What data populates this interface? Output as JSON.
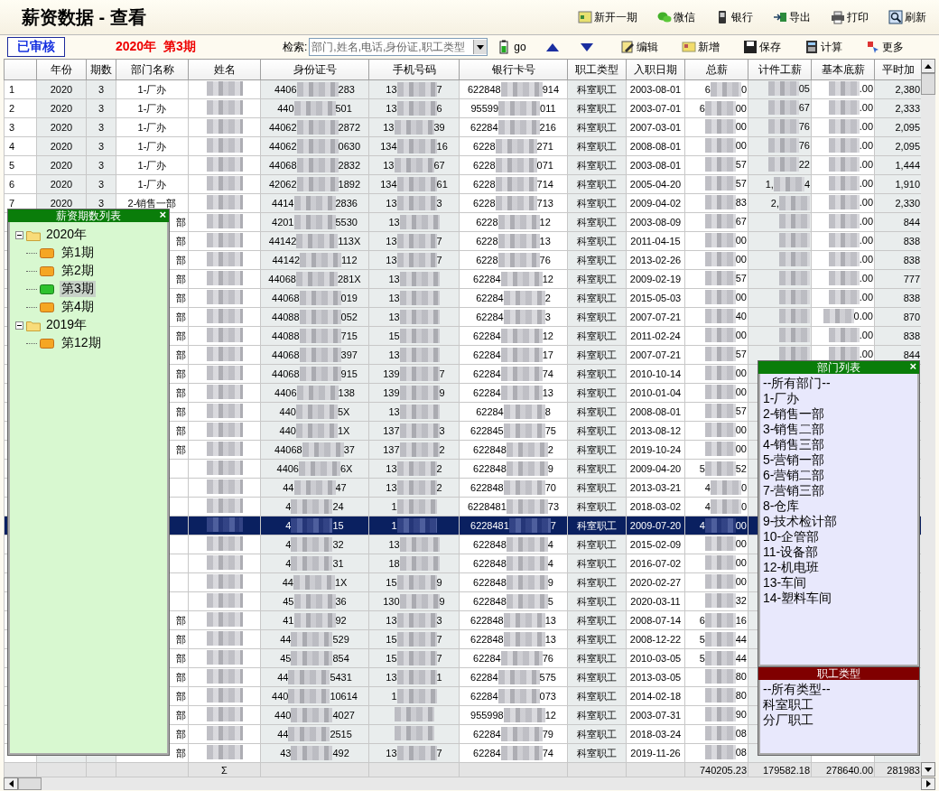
{
  "title": "薪资数据 - 查看",
  "top_actions": [
    "新开一期",
    "微信",
    "银行",
    "导出",
    "打印",
    "刷新"
  ],
  "status_badge": "已审核",
  "period_label": "2020年  第3期",
  "search": {
    "label": "检索:",
    "placeholder": "部门,姓名,电话,身份证,职工类型",
    "go": "go"
  },
  "edit_actions": [
    "编辑",
    "新增",
    "保存",
    "计算",
    "更多"
  ],
  "columns": [
    "年份",
    "期数",
    "部门名称",
    "姓名",
    "身份证号",
    "手机号码",
    "银行卡号",
    "职工类型",
    "入职日期",
    "总薪",
    "计件工薪",
    "基本底薪",
    "平时加"
  ],
  "rows": [
    {
      "selected": false,
      "cells": [
        "1",
        "2020",
        "3",
        "1-厂办",
        {
          "blurred": true
        },
        {
          "pre": "4406",
          "post": "283"
        },
        {
          "pre": "13",
          "post": "7"
        },
        {
          "pre": "622848",
          "post": "914"
        },
        "科室职工",
        "2003-08-01",
        {
          "pre": "6",
          "post": "0"
        },
        {
          "post": "05"
        },
        {
          "post": ".00"
        },
        "2,380"
      ]
    },
    {
      "selected": false,
      "cells": [
        "2",
        "2020",
        "3",
        "1-厂办",
        {
          "blurred": true
        },
        {
          "pre": "440",
          "post": "501"
        },
        {
          "pre": "13",
          "post": "6"
        },
        {
          "pre": "95599",
          "post": "011"
        },
        "科室职工",
        "2003-07-01",
        {
          "pre": "6",
          "post": "00"
        },
        {
          "post": "67"
        },
        {
          "post": ".00"
        },
        "2,333"
      ]
    },
    {
      "selected": false,
      "cells": [
        "3",
        "2020",
        "3",
        "1-厂办",
        {
          "blurred": true
        },
        {
          "pre": "44062",
          "post": "2872"
        },
        {
          "pre": "13",
          "post": "39"
        },
        {
          "pre": "62284",
          "post": "216"
        },
        "科室职工",
        "2007-03-01",
        {
          "post": "00"
        },
        {
          "post": "76"
        },
        {
          "post": ".00"
        },
        "2,095"
      ]
    },
    {
      "selected": false,
      "cells": [
        "4",
        "2020",
        "3",
        "1-厂办",
        {
          "blurred": true
        },
        {
          "pre": "44062",
          "post": "0630"
        },
        {
          "pre": "134",
          "post": "16"
        },
        {
          "pre": "6228",
          "post": "271"
        },
        "科室职工",
        "2008-08-01",
        {
          "post": "00"
        },
        {
          "post": "76"
        },
        {
          "post": ".00"
        },
        "2,095"
      ]
    },
    {
      "selected": false,
      "cells": [
        "5",
        "2020",
        "3",
        "1-厂办",
        {
          "blurred": true
        },
        {
          "pre": "44068",
          "post": "2832"
        },
        {
          "pre": "13",
          "post": "67"
        },
        {
          "pre": "6228",
          "post": "071"
        },
        "科室职工",
        "2003-08-01",
        {
          "post": "57"
        },
        {
          "post": "22"
        },
        {
          "post": ".00"
        },
        "1,444"
      ]
    },
    {
      "selected": false,
      "cells": [
        "6",
        "2020",
        "3",
        "1-厂办",
        {
          "blurred": true
        },
        {
          "pre": "42062",
          "post": "1892"
        },
        {
          "pre": "134",
          "post": "61"
        },
        {
          "pre": "6228",
          "post": "714"
        },
        "科室职工",
        "2005-04-20",
        {
          "post": "57"
        },
        {
          "pre": "1,",
          "post": "4"
        },
        {
          "post": ".00"
        },
        "1,910"
      ]
    },
    {
      "selected": false,
      "cells": [
        "7",
        "2020",
        "3",
        "2-销售一部",
        {
          "blurred": true
        },
        {
          "pre": "4414",
          "post": "2836"
        },
        {
          "pre": "13",
          "post": "3"
        },
        {
          "pre": "6228",
          "post": "713"
        },
        "科室职工",
        "2009-04-02",
        {
          "post": "83"
        },
        {
          "pre": "2,"
        },
        {
          "post": ".00"
        },
        "2,330"
      ]
    },
    {
      "selected": false,
      "cells": [
        null,
        null,
        null,
        "部",
        {
          "blurred": true
        },
        {
          "pre": "4201",
          "post": "5530"
        },
        {
          "pre": "13"
        },
        {
          "pre": "6228",
          "post": "12"
        },
        "科室职工",
        "2003-08-09",
        {
          "post": "67"
        },
        {
          "blurred": true
        },
        {
          "post": ".00"
        },
        "844"
      ]
    },
    {
      "selected": false,
      "cells": [
        null,
        null,
        null,
        "部",
        {
          "blurred": true
        },
        {
          "pre": "44142",
          "post": "113X"
        },
        {
          "pre": "13",
          "post": "7"
        },
        {
          "pre": "6228",
          "post": "13"
        },
        "科室职工",
        "2011-04-15",
        {
          "post": "00"
        },
        {
          "blurred": true
        },
        {
          "post": ".00"
        },
        "838"
      ]
    },
    {
      "selected": false,
      "cells": [
        null,
        null,
        null,
        "部",
        {
          "blurred": true
        },
        {
          "pre": "44142",
          "post": "112"
        },
        {
          "pre": "13",
          "post": "7"
        },
        {
          "pre": "6228",
          "post": "76"
        },
        "科室职工",
        "2013-02-26",
        {
          "post": "00"
        },
        {
          "blurred": true
        },
        {
          "post": ".00"
        },
        "838"
      ]
    },
    {
      "selected": false,
      "cells": [
        null,
        null,
        null,
        "部",
        {
          "blurred": true
        },
        {
          "pre": "44068",
          "post": "281X"
        },
        {
          "pre": "13"
        },
        {
          "pre": "62284",
          "post": "12"
        },
        "科室职工",
        "2009-02-19",
        {
          "post": "57"
        },
        {
          "blurred": true
        },
        {
          "post": ".00"
        },
        "777"
      ]
    },
    {
      "selected": false,
      "cells": [
        null,
        null,
        null,
        "部",
        {
          "blurred": true
        },
        {
          "pre": "44068",
          "post": "019"
        },
        {
          "pre": "13"
        },
        {
          "pre": "62284",
          "post": "2"
        },
        "科室职工",
        "2015-05-03",
        {
          "post": "00"
        },
        {
          "blurred": true
        },
        {
          "post": ".00"
        },
        "838"
      ]
    },
    {
      "selected": false,
      "cells": [
        null,
        null,
        null,
        "部",
        {
          "blurred": true
        },
        {
          "pre": "44088",
          "post": "052"
        },
        {
          "pre": "13"
        },
        {
          "pre": "62284",
          "post": "3"
        },
        "科室职工",
        "2007-07-21",
        {
          "post": "40"
        },
        {
          "blurred": true
        },
        {
          "post": "0.00"
        },
        "870"
      ]
    },
    {
      "selected": false,
      "cells": [
        null,
        null,
        null,
        "部",
        {
          "blurred": true
        },
        {
          "pre": "44088",
          "post": "715"
        },
        {
          "pre": "15"
        },
        {
          "pre": "62284",
          "post": "12"
        },
        "科室职工",
        "2011-02-24",
        {
          "post": "00"
        },
        {
          "blurred": true
        },
        {
          "post": ".00"
        },
        "838"
      ]
    },
    {
      "selected": false,
      "cells": [
        null,
        null,
        null,
        "部",
        {
          "blurred": true
        },
        {
          "pre": "44068",
          "post": "397"
        },
        {
          "pre": "13"
        },
        {
          "pre": "62284",
          "post": "17"
        },
        "科室职工",
        "2007-07-21",
        {
          "post": "57"
        },
        {
          "blurred": true
        },
        {
          "post": ".00"
        },
        "844"
      ]
    },
    {
      "selected": false,
      "cells": [
        null,
        null,
        null,
        "部",
        {
          "blurred": true
        },
        {
          "pre": "44068",
          "post": "915"
        },
        {
          "pre": "139",
          "post": "7"
        },
        {
          "pre": "62284",
          "post": "74"
        },
        "科室职工",
        "2010-10-14",
        {
          "post": "00"
        },
        null,
        null,
        null
      ]
    },
    {
      "selected": false,
      "cells": [
        null,
        null,
        null,
        "部",
        {
          "blurred": true
        },
        {
          "pre": "4406",
          "post": "138"
        },
        {
          "pre": "139",
          "post": "9"
        },
        {
          "pre": "62284",
          "post": "13"
        },
        "科室职工",
        "2010-01-04",
        {
          "post": "00"
        },
        null,
        null,
        null
      ]
    },
    {
      "selected": false,
      "cells": [
        null,
        null,
        null,
        "部",
        {
          "blurred": true
        },
        {
          "pre": "440",
          "post": "5X"
        },
        {
          "pre": "13"
        },
        {
          "pre": "62284",
          "post": "8"
        },
        "科室职工",
        "2008-08-01",
        {
          "post": "57"
        },
        null,
        null,
        null
      ]
    },
    {
      "selected": false,
      "cells": [
        null,
        null,
        null,
        "部",
        {
          "blurred": true
        },
        {
          "pre": "440",
          "post": "1X"
        },
        {
          "pre": "137",
          "post": "3"
        },
        {
          "pre": "622845",
          "post": "75"
        },
        "科室职工",
        "2013-08-12",
        {
          "post": "00"
        },
        null,
        null,
        null
      ]
    },
    {
      "selected": false,
      "cells": [
        null,
        null,
        null,
        "部",
        {
          "blurred": true
        },
        {
          "pre": "44068",
          "post": "37"
        },
        {
          "pre": "137",
          "post": "2"
        },
        {
          "pre": "622848",
          "post": "2"
        },
        "科室职工",
        "2019-10-24",
        {
          "post": "00"
        },
        null,
        null,
        null
      ]
    },
    {
      "selected": false,
      "cells": [
        null,
        null,
        null,
        null,
        {
          "blurred": true
        },
        {
          "pre": "4406",
          "post": "6X"
        },
        {
          "pre": "13",
          "post": "2"
        },
        {
          "pre": "622848",
          "post": "9"
        },
        "科室职工",
        "2009-04-20",
        {
          "pre": "5",
          "post": "52"
        },
        null,
        null,
        null
      ]
    },
    {
      "selected": false,
      "cells": [
        null,
        null,
        null,
        null,
        {
          "blurred": true
        },
        {
          "pre": "44",
          "post": "47"
        },
        {
          "pre": "13",
          "post": "2"
        },
        {
          "pre": "622848",
          "post": "70"
        },
        "科室职工",
        "2013-03-21",
        {
          "pre": "4",
          "post": "0"
        },
        null,
        null,
        null
      ]
    },
    {
      "selected": false,
      "cells": [
        null,
        null,
        null,
        null,
        {
          "blurred": true
        },
        {
          "pre": "4",
          "post": "24"
        },
        {
          "pre": "1"
        },
        {
          "pre": "6228481",
          "post": "73"
        },
        "科室职工",
        "2018-03-02",
        {
          "pre": "4",
          "post": "0"
        },
        null,
        null,
        null
      ]
    },
    {
      "selected": true,
      "cells": [
        null,
        null,
        null,
        null,
        {
          "blurred": true
        },
        {
          "pre": "4",
          "post": "15"
        },
        {
          "pre": "1"
        },
        {
          "pre": "6228481",
          "post": "7"
        },
        "科室职工",
        "2009-07-20",
        {
          "pre": "4",
          "post": "00"
        },
        null,
        null,
        null
      ]
    },
    {
      "selected": false,
      "cells": [
        null,
        null,
        null,
        null,
        {
          "blurred": true
        },
        {
          "pre": "4",
          "post": "32"
        },
        {
          "pre": "13"
        },
        {
          "pre": "622848",
          "post": "4"
        },
        "科室职工",
        "2015-02-09",
        {
          "post": "00"
        },
        null,
        null,
        null
      ]
    },
    {
      "selected": false,
      "cells": [
        null,
        null,
        null,
        null,
        {
          "blurred": true
        },
        {
          "pre": "4",
          "post": "31"
        },
        {
          "pre": "18"
        },
        {
          "pre": "622848",
          "post": "4"
        },
        "科室职工",
        "2016-07-02",
        {
          "post": "00"
        },
        null,
        null,
        null
      ]
    },
    {
      "selected": false,
      "cells": [
        null,
        null,
        null,
        null,
        {
          "blurred": true
        },
        {
          "pre": "44",
          "post": "1X"
        },
        {
          "pre": "15",
          "post": "9"
        },
        {
          "pre": "622848",
          "post": "9"
        },
        "科室职工",
        "2020-02-27",
        {
          "post": "00"
        },
        null,
        null,
        null
      ]
    },
    {
      "selected": false,
      "cells": [
        null,
        null,
        null,
        null,
        {
          "blurred": true
        },
        {
          "pre": "45",
          "post": "36"
        },
        {
          "pre": "130",
          "post": "9"
        },
        {
          "pre": "622848",
          "post": "5"
        },
        "科室职工",
        "2020-03-11",
        {
          "post": "32"
        },
        null,
        null,
        null
      ]
    },
    {
      "selected": false,
      "cells": [
        null,
        null,
        null,
        "部",
        {
          "blurred": true
        },
        {
          "pre": "41",
          "post": "92"
        },
        {
          "pre": "13",
          "post": "3"
        },
        {
          "pre": "622848",
          "post": "13"
        },
        "科室职工",
        "2008-07-14",
        {
          "pre": "6",
          "post": "16"
        },
        null,
        null,
        null
      ]
    },
    {
      "selected": false,
      "cells": [
        null,
        null,
        null,
        "部",
        {
          "blurred": true
        },
        {
          "pre": "44",
          "post": "529"
        },
        {
          "pre": "15",
          "post": "7"
        },
        {
          "pre": "622848",
          "post": "13"
        },
        "科室职工",
        "2008-12-22",
        {
          "pre": "5",
          "post": "44"
        },
        null,
        null,
        null
      ]
    },
    {
      "selected": false,
      "cells": [
        null,
        null,
        null,
        "部",
        {
          "blurred": true
        },
        {
          "pre": "45",
          "post": "854"
        },
        {
          "pre": "15",
          "post": "7"
        },
        {
          "pre": "62284",
          "post": "76"
        },
        "科室职工",
        "2010-03-05",
        {
          "pre": "5",
          "post": "44"
        },
        null,
        null,
        null
      ]
    },
    {
      "selected": false,
      "cells": [
        null,
        null,
        null,
        "部",
        {
          "blurred": true
        },
        {
          "pre": "44",
          "post": "5431"
        },
        {
          "pre": "13",
          "post": "1"
        },
        {
          "pre": "62284",
          "post": "575"
        },
        "科室职工",
        "2013-03-05",
        {
          "post": "80"
        },
        null,
        null,
        null
      ]
    },
    {
      "selected": false,
      "cells": [
        null,
        null,
        null,
        "部",
        {
          "blurred": true
        },
        {
          "pre": "440",
          "post": "10614"
        },
        {
          "pre": "1"
        },
        {
          "pre": "62284",
          "post": "073"
        },
        "科室职工",
        "2014-02-18",
        {
          "post": "80"
        },
        null,
        null,
        null
      ]
    },
    {
      "selected": false,
      "cells": [
        null,
        null,
        null,
        "部",
        {
          "blurred": true
        },
        {
          "pre": "440",
          "post": "4027"
        },
        {
          "blurred": true
        },
        {
          "pre": "955998",
          "post": "12"
        },
        "科室职工",
        "2003-07-31",
        {
          "post": "90"
        },
        null,
        null,
        null
      ]
    },
    {
      "selected": false,
      "cells": [
        null,
        null,
        null,
        "部",
        {
          "blurred": true
        },
        {
          "pre": "44",
          "post": "2515"
        },
        {
          "blurred": true
        },
        {
          "pre": "62284",
          "post": "79"
        },
        "科室职工",
        "2018-03-24",
        {
          "post": "08"
        },
        null,
        null,
        null
      ]
    },
    {
      "selected": false,
      "cells": [
        null,
        null,
        null,
        "部",
        {
          "blurred": true
        },
        {
          "pre": "43",
          "post": "492"
        },
        {
          "pre": "13",
          "post": "7"
        },
        {
          "pre": "62284",
          "post": "74"
        },
        "科室职工",
        "2019-11-26",
        {
          "post": "08"
        },
        null,
        null,
        null
      ]
    }
  ],
  "sum_row": {
    "sigma": "Σ",
    "total": "740205.23",
    "piece": "179582.18",
    "base": "278640.00",
    "overtime": "281983"
  },
  "period_panel": {
    "title": "薪资期数列表",
    "close": "×",
    "tree": [
      {
        "label": "2020年",
        "expanded": true,
        "children": [
          {
            "label": "第1期",
            "selected": false
          },
          {
            "label": "第2期",
            "selected": false
          },
          {
            "label": "第3期",
            "selected": true
          },
          {
            "label": "第4期",
            "selected": false
          }
        ]
      },
      {
        "label": "2019年",
        "expanded": true,
        "children": [
          {
            "label": "第12期",
            "selected": false
          }
        ]
      }
    ]
  },
  "dept_panel": {
    "title": "部门列表",
    "close": "×",
    "items": [
      "--所有部门--",
      "1-厂办",
      "2-销售一部",
      "3-销售二部",
      "4-销售三部",
      "5-营销一部",
      "6-营销二部",
      "7-营销三部",
      "8-仓库",
      "9-技术检计部",
      "10-企管部",
      "11-设备部",
      "12-机电班",
      "13-车间",
      "14-塑料车间"
    ]
  },
  "type_panel": {
    "title": "职工类型",
    "items": [
      "--所有类型--",
      "科室职工",
      "分厂职工"
    ]
  }
}
